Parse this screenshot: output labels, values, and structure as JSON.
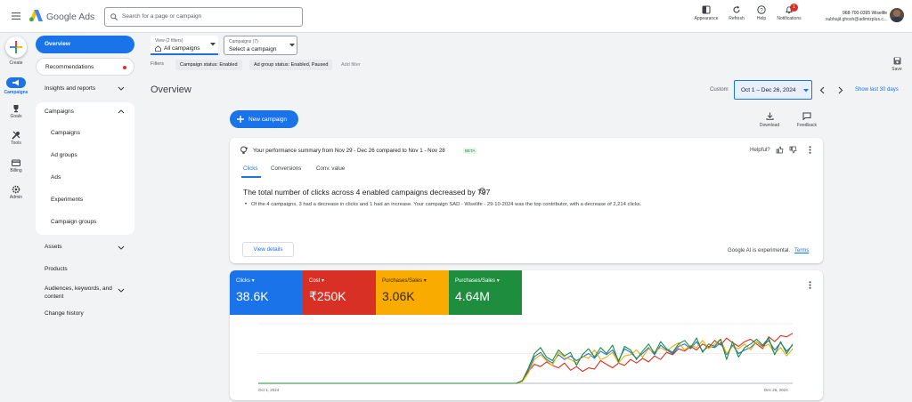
{
  "header": {
    "app_name": "Google Ads",
    "search_placeholder": "Search for a page or campaign",
    "buttons": {
      "appearance": "Appearance",
      "refresh": "Refresh",
      "help": "Help",
      "notifications": "Notifications"
    },
    "notification_count": "1",
    "account_line": "968-700-0395 Wiselife",
    "email": "subhajit.ghosh@adimizplus.c..."
  },
  "rail": {
    "create": "Create",
    "campaigns": "Campaigns",
    "goals": "Goals",
    "tools": "Tools",
    "billing": "Billing",
    "admin": "Admin"
  },
  "nav": {
    "overview": "Overview",
    "recommendations": "Recommendations",
    "insights": "Insights and reports",
    "campaigns": "Campaigns",
    "campaign_children": [
      "Campaigns",
      "Ad groups",
      "Ads",
      "Experiments",
      "Campaign groups"
    ],
    "assets": "Assets",
    "products": "Products",
    "audiences": "Audiences, keywords, and content",
    "change_history": "Change history"
  },
  "toolbar": {
    "view_label": "View (2 filters)",
    "view_value": "All campaigns",
    "campaigns_label": "Campaigns (7)",
    "campaigns_value": "Select a campaign",
    "filters_label": "Filters",
    "filter_chips": [
      "Campaign status: Enabled",
      "Ad group status: Enabled, Paused"
    ],
    "add_filter": "Add filter",
    "save": "Save"
  },
  "page": {
    "title": "Overview",
    "custom_label": "Custom",
    "date_range": "Oct 1 – Dec 26, 2024",
    "show_last": "Show last 30 days",
    "new_campaign": "New campaign",
    "download": "Download",
    "feedback": "Feedback"
  },
  "summary": {
    "heading": "Your performance summary from Nov 29 - Dec 26 compared to Nov 1 - Nov 28",
    "beta": "BETA",
    "helpful": "Helpful?",
    "tabs": [
      "Clicks",
      "Conversions",
      "Conv. value"
    ],
    "headline": "The total number of clicks across 4 enabled campaigns decreased by 797",
    "bullet": "Of the 4 campaigns, 3 had a decrease in clicks and 1 had an increase. Your campaign SAD - Wiselife - 29-10-2024 was the top contributor, with a decrease of 2,214 clicks.",
    "view_details": "View details",
    "ai_note": "Google AI is experimental.",
    "terms": "Terms"
  },
  "metrics": [
    {
      "label": "Clicks",
      "value": "38.6K",
      "color": "#1a73e8"
    },
    {
      "label": "Cost",
      "value": "₹250K",
      "color": "#d93025"
    },
    {
      "label": "Purchases/Sales",
      "value": "3.06K",
      "color": "#f9ab00"
    },
    {
      "label": "Purchases/Sales",
      "value": "4.64M",
      "color": "#1e8e3e"
    }
  ],
  "chart_data": {
    "type": "line",
    "x_start": "Oct 1, 2024",
    "x_end": "Dec 26, 2024",
    "series": [
      {
        "color": "#1a73e8",
        "values": [
          0,
          0,
          0,
          0,
          0,
          0,
          0,
          0,
          0,
          0,
          0,
          0,
          0,
          0,
          0,
          0,
          0,
          0,
          0,
          0,
          0,
          0,
          0,
          0,
          0,
          0,
          0,
          0,
          0,
          0,
          0,
          0,
          0,
          0,
          0,
          0,
          0,
          0,
          0,
          0,
          0,
          0,
          0,
          0,
          4,
          22,
          45,
          52,
          40,
          34,
          48,
          40,
          46,
          38,
          44,
          50,
          42,
          54,
          48,
          56,
          38,
          58,
          52,
          42,
          50,
          60,
          48,
          64,
          56,
          50,
          62,
          66,
          58,
          70,
          54,
          62,
          60,
          68,
          48,
          64,
          50,
          56,
          60,
          70,
          62,
          72,
          56,
          68,
          54,
          64
        ]
      },
      {
        "color": "#d93025",
        "values": [
          0,
          0,
          0,
          0,
          0,
          0,
          0,
          0,
          0,
          0,
          0,
          0,
          0,
          0,
          0,
          0,
          0,
          0,
          0,
          0,
          0,
          0,
          0,
          0,
          0,
          0,
          0,
          0,
          0,
          0,
          0,
          0,
          0,
          0,
          0,
          0,
          0,
          0,
          0,
          0,
          0,
          0,
          0,
          0,
          4,
          20,
          32,
          28,
          36,
          30,
          26,
          34,
          22,
          28,
          20,
          26,
          24,
          38,
          32,
          26,
          34,
          30,
          40,
          34,
          42,
          36,
          46,
          40,
          52,
          48,
          58,
          54,
          62,
          56,
          66,
          60,
          72,
          64,
          76,
          68,
          62,
          70,
          74,
          66,
          58,
          78,
          70,
          80,
          78,
          84
        ]
      },
      {
        "color": "#f9ab00",
        "values": [
          0,
          0,
          0,
          0,
          0,
          0,
          0,
          0,
          0,
          0,
          0,
          0,
          0,
          0,
          0,
          0,
          0,
          0,
          0,
          0,
          0,
          0,
          0,
          0,
          0,
          0,
          0,
          0,
          0,
          0,
          0,
          0,
          0,
          0,
          0,
          0,
          0,
          0,
          0,
          0,
          0,
          0,
          0,
          0,
          3,
          18,
          40,
          48,
          38,
          30,
          52,
          44,
          40,
          34,
          46,
          42,
          56,
          40,
          44,
          52,
          34,
          46,
          48,
          56,
          44,
          58,
          52,
          60,
          54,
          62,
          68,
          56,
          64,
          60,
          72,
          58,
          66,
          74,
          50,
          62,
          58,
          66,
          56,
          70,
          60,
          66,
          50,
          60,
          46,
          58
        ]
      },
      {
        "color": "#1e8e3e",
        "values": [
          0,
          0,
          0,
          0,
          0,
          0,
          0,
          0,
          0,
          0,
          0,
          0,
          0,
          0,
          0,
          0,
          0,
          0,
          0,
          0,
          0,
          0,
          0,
          0,
          0,
          0,
          0,
          0,
          0,
          0,
          0,
          0,
          0,
          0,
          0,
          0,
          0,
          0,
          0,
          0,
          0,
          0,
          0,
          0,
          5,
          26,
          50,
          60,
          44,
          38,
          56,
          46,
          52,
          30,
          48,
          58,
          44,
          60,
          50,
          64,
          36,
          62,
          56,
          40,
          54,
          66,
          50,
          70,
          58,
          52,
          66,
          72,
          60,
          76,
          52,
          66,
          62,
          74,
          40,
          70,
          44,
          60,
          66,
          74,
          64,
          76,
          48,
          70,
          50,
          66
        ]
      }
    ]
  }
}
